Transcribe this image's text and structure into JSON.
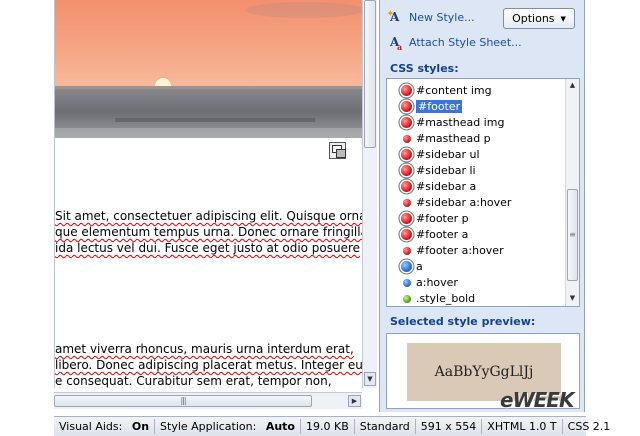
{
  "design_view": {
    "paragraph1": [
      "Sit amet, consectetuer adipiscing elit. Quisque ornar",
      "que elementum tempus urna. Donec ornare fringilla",
      "ida lectus vel dui. Fusce eget justo at odio posuere"
    ],
    "paragraph2": [
      " amet viverra rhoncus, mauris urna interdum erat,",
      "libero. Donec adipiscing placerat metus. Integer eu",
      "e consequat. Curabitur sem erat, tempor non,"
    ]
  },
  "panel": {
    "new_style_label": "New Style...",
    "attach_label": "Attach Style Sheet...",
    "options_label": "Options",
    "css_styles_label": "CSS styles:",
    "styles": [
      {
        "name": "#content img",
        "icon": "red-ring"
      },
      {
        "name": "#footer",
        "icon": "red-ring",
        "selected": true
      },
      {
        "name": "#masthead img",
        "icon": "red-ring"
      },
      {
        "name": "#masthead p",
        "icon": "red-small"
      },
      {
        "name": "#sidebar ul",
        "icon": "red-ring"
      },
      {
        "name": "#sidebar li",
        "icon": "red-ring"
      },
      {
        "name": "#sidebar a",
        "icon": "red-ring"
      },
      {
        "name": "#sidebar a:hover",
        "icon": "red-small"
      },
      {
        "name": "#footer p",
        "icon": "red-ring"
      },
      {
        "name": "#footer a",
        "icon": "red-ring"
      },
      {
        "name": "#footer a:hover",
        "icon": "red-small"
      },
      {
        "name": "a",
        "icon": "blue-ring"
      },
      {
        "name": "a:hover",
        "icon": "blue-small"
      },
      {
        "name": ".style_bold",
        "icon": "green-small"
      }
    ],
    "preview_label": "Selected style preview:",
    "preview_text": "AaBbYyGgLlJj"
  },
  "watermark": "eWEEK",
  "status_bar": {
    "visual_aids_label": "Visual Aids:",
    "visual_aids_value": "On",
    "style_application_label": "Style Application:",
    "style_application_value": "Auto",
    "file_size": "19.0 KB",
    "mode": "Standard",
    "dimensions": "591 x 554",
    "doctype": "XHTML 1.0 T",
    "css_version": "CSS 2.1"
  },
  "colors": {
    "panel_bg": "#dce6f4",
    "header_text": "#15428b",
    "link_text": "#1a4fa6",
    "selection": "#3875d7",
    "preview_swatch": "#dbc9b8"
  }
}
